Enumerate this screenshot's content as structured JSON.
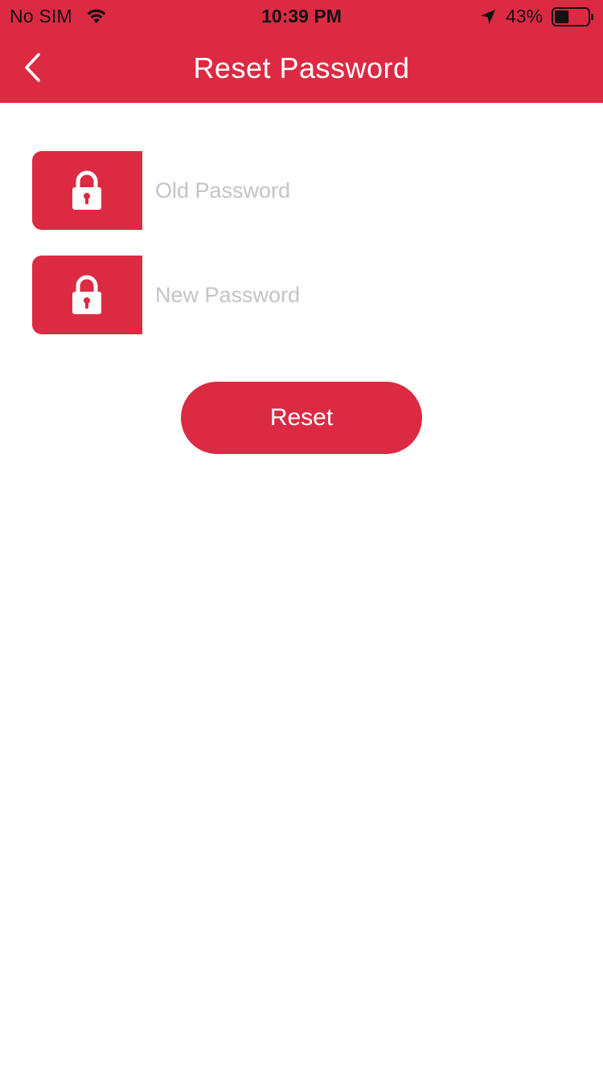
{
  "status_bar": {
    "carrier": "No SIM",
    "time": "10:39 PM",
    "battery_percent": "43%",
    "battery_level": 0.43,
    "icons": [
      "wifi-icon",
      "location-arrow-icon",
      "battery-icon"
    ]
  },
  "nav": {
    "title": "Reset Password",
    "back_icon": "chevron-left-icon"
  },
  "form": {
    "old_password": {
      "value": "",
      "placeholder": "Old Password",
      "icon": "lock-icon"
    },
    "new_password": {
      "value": "",
      "placeholder": "New Password",
      "icon": "lock-icon"
    },
    "submit_label": "Reset"
  },
  "colors": {
    "brand": "#dc2a43",
    "background": "#ffffff",
    "placeholder": "#c3c3c9"
  }
}
